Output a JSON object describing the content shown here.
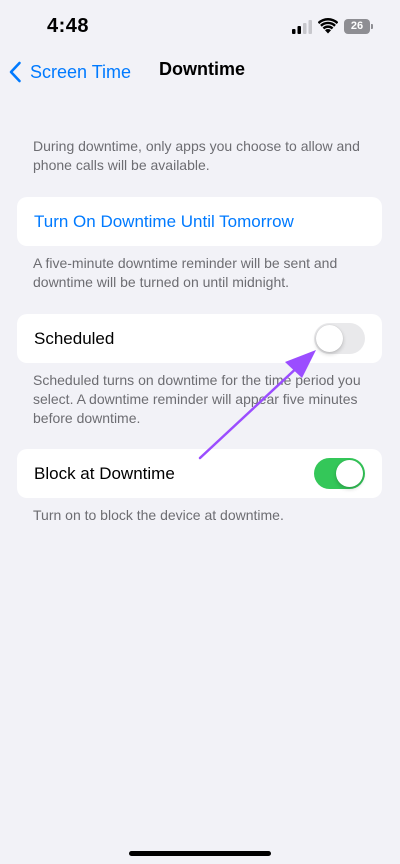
{
  "status_bar": {
    "time": "4:48",
    "battery": "26"
  },
  "nav": {
    "back_label": "Screen Time",
    "title": "Downtime"
  },
  "intro_note": "During downtime, only apps you choose to allow and phone calls will be available.",
  "turn_on_link": "Turn On Downtime Until Tomorrow",
  "turn_on_note": "A five-minute downtime reminder will be sent and downtime will be turned on until midnight.",
  "scheduled": {
    "label": "Scheduled",
    "enabled": false,
    "note": "Scheduled turns on downtime for the time period you select. A downtime reminder will appear five minutes before downtime."
  },
  "block": {
    "label": "Block at Downtime",
    "enabled": true,
    "note": "Turn on to block the device at downtime."
  },
  "colors": {
    "accent": "#007aff",
    "toggle_on": "#34c759",
    "annotation_arrow": "#9b4dff"
  }
}
